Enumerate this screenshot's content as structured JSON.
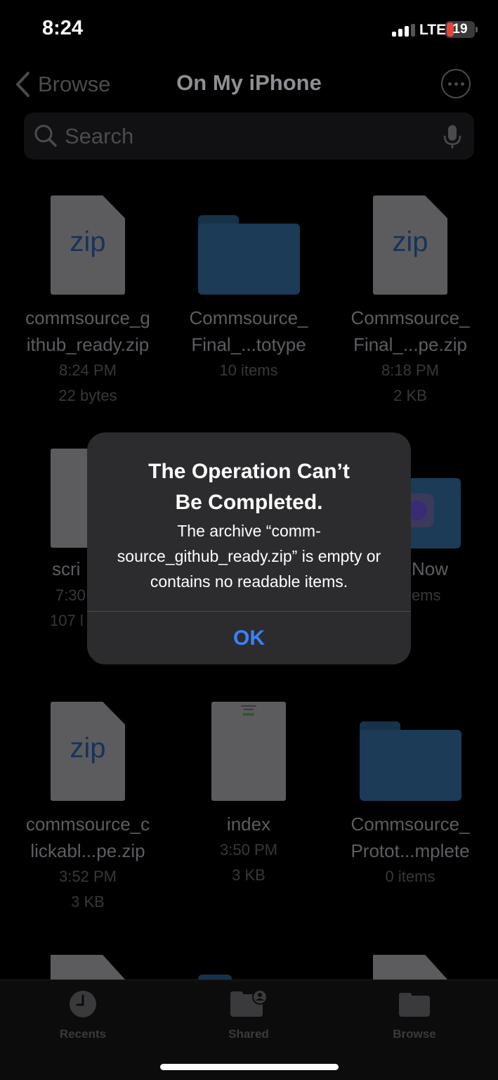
{
  "status": {
    "time": "8:24",
    "network": "LTE",
    "battery": "19"
  },
  "nav": {
    "back_label": "Browse",
    "title": "On My iPhone"
  },
  "search": {
    "placeholder": "Search"
  },
  "files": [
    {
      "name_line1": "commsource_g",
      "name_line2": "ithub_ready.zip",
      "meta1": "8:24 PM",
      "meta2": "22 bytes",
      "icon": "zip-file-icon",
      "badge": "zip"
    },
    {
      "name_line1": "Commsource_",
      "name_line2": "Final_...totype",
      "meta1": "10 items",
      "icon": "folder-icon"
    },
    {
      "name_line1": "Commsource_",
      "name_line2": "Final_...pe.zip",
      "meta1": "8:18 PM",
      "meta2": "2 KB",
      "icon": "zip-file-icon",
      "badge": "zip"
    },
    {
      "name_line1": "scri",
      "meta1": "7:30",
      "meta2": "107 l",
      "icon": "document-thumbnail-icon"
    },
    {
      "name_line1": "Now",
      "meta1": "ems",
      "icon": "app-folder-icon"
    },
    {
      "name_line1": "commsource_c",
      "name_line2": "lickabl...pe.zip",
      "meta1": "3:52 PM",
      "meta2": "3 KB",
      "icon": "zip-file-icon",
      "badge": "zip"
    },
    {
      "name_line1": "index",
      "meta1": "3:50 PM",
      "meta2": "3 KB",
      "icon": "html-document-icon"
    },
    {
      "name_line1": "Commsource_",
      "name_line2": "Protot...mplete",
      "meta1": "0 items",
      "icon": "folder-icon"
    }
  ],
  "alert": {
    "title_line1": "The Operation Can’t",
    "title_line2": "Be Completed.",
    "message": "The archive “comm-source_github_ready.zip” is empty or contains no readable items.",
    "ok_label": "OK"
  },
  "tabbar": {
    "items": [
      {
        "label": "Recents",
        "icon": "clock-icon"
      },
      {
        "label": "Shared",
        "icon": "shared-folder-icon"
      },
      {
        "label": "Browse",
        "icon": "folder-icon"
      }
    ]
  },
  "colors": {
    "accent": "#3a82f7",
    "battery_low": "#e8433b",
    "alert_bg": "#2c2c2e"
  }
}
